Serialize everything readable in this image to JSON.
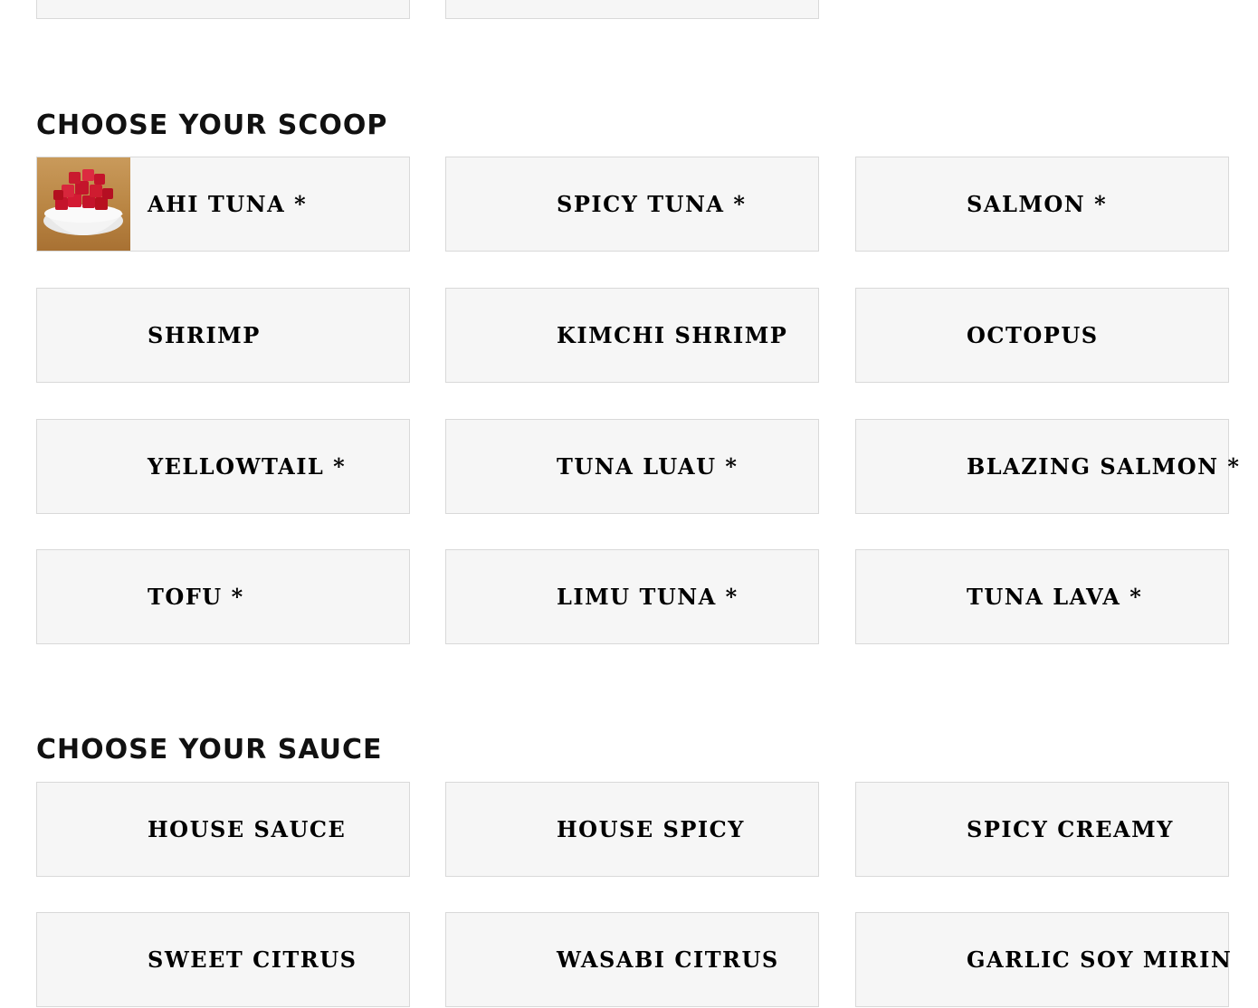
{
  "scoop_section": {
    "title": "Choose Your Scoop",
    "items": [
      {
        "label": "Ahi Tuna *",
        "image": "ahi-tuna-bowl"
      },
      {
        "label": "Spicy Tuna *"
      },
      {
        "label": "Salmon *"
      },
      {
        "label": "Shrimp"
      },
      {
        "label": "Kimchi Shrimp"
      },
      {
        "label": "Octopus"
      },
      {
        "label": "Yellowtail *"
      },
      {
        "label": "Tuna Luau *"
      },
      {
        "label": "Blazing Salmon *"
      },
      {
        "label": "Tofu *"
      },
      {
        "label": "Limu Tuna *"
      },
      {
        "label": "Tuna Lava *"
      }
    ]
  },
  "sauce_section": {
    "title": "Choose Your Sauce",
    "items": [
      {
        "label": "House Sauce"
      },
      {
        "label": "House Spicy"
      },
      {
        "label": "Spicy Creamy"
      },
      {
        "label": "Sweet Citrus"
      },
      {
        "label": "Wasabi Citrus"
      },
      {
        "label": "Garlic Soy Mirin"
      }
    ]
  }
}
